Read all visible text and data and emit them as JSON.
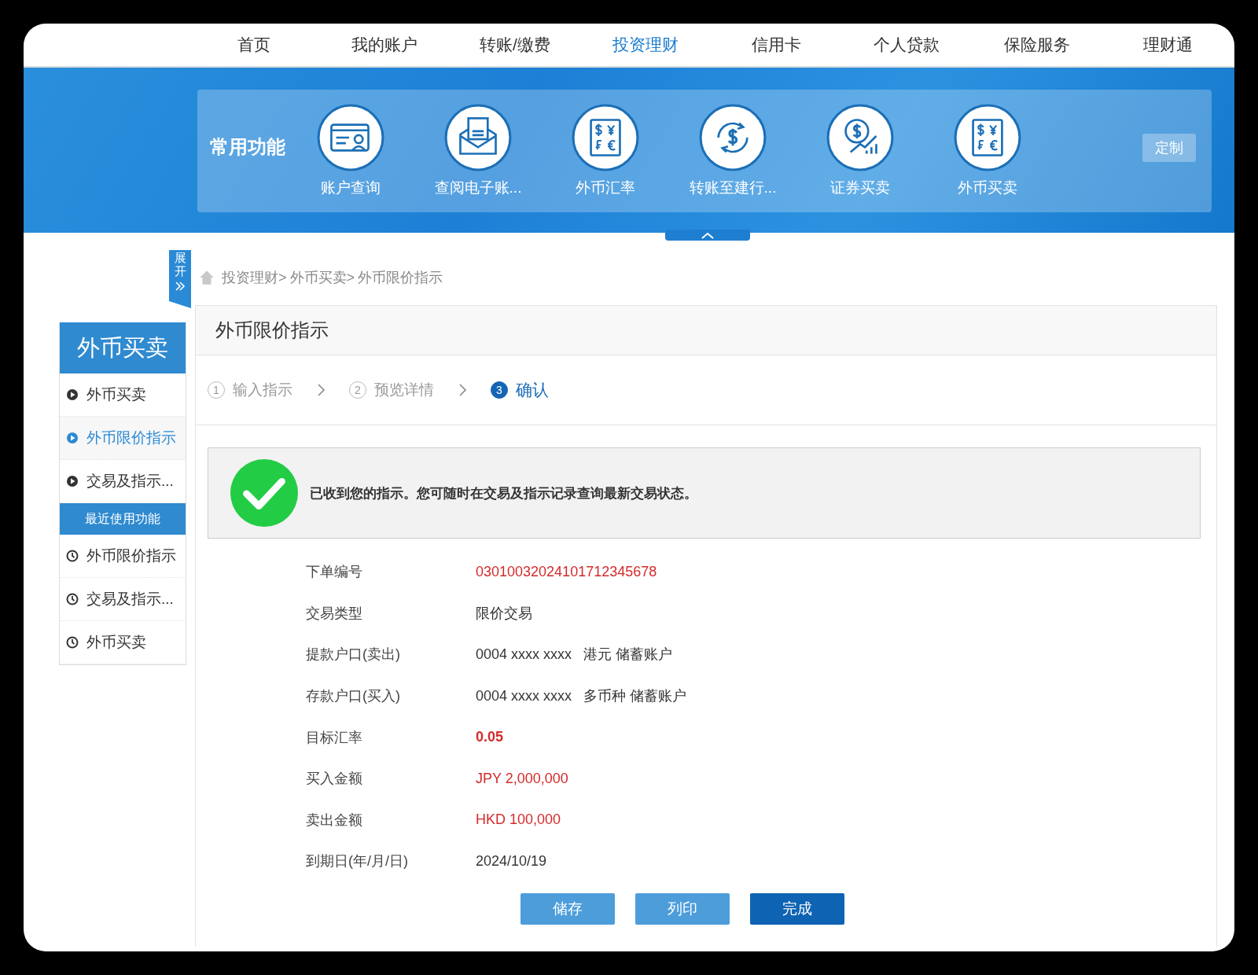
{
  "nav": [
    {
      "label": "首页",
      "selected": false
    },
    {
      "label": "我的账户",
      "selected": false
    },
    {
      "label": "转账/缴费",
      "selected": false
    },
    {
      "label": "投资理财",
      "selected": true
    },
    {
      "label": "信用卡",
      "selected": false
    },
    {
      "label": "个人贷款",
      "selected": false
    },
    {
      "label": "保险服务",
      "selected": false
    },
    {
      "label": "理财通",
      "selected": false
    }
  ],
  "quick": {
    "title": "常用功能",
    "customize": "定制",
    "items": [
      {
        "kind": "card",
        "label": "账户查询"
      },
      {
        "kind": "envelope",
        "label": "查阅电子账..."
      },
      {
        "kind": "currency",
        "label": "外币汇率"
      },
      {
        "kind": "transfer",
        "label": "转账至建行..."
      },
      {
        "kind": "chart",
        "label": "证券买卖"
      },
      {
        "kind": "currency",
        "label": "外币买卖"
      }
    ]
  },
  "expand_tab": "展开",
  "breadcrumb": [
    "投资理财>",
    "外币买卖>",
    "外币限价指示"
  ],
  "sidebar": {
    "title": "外币买卖",
    "items": [
      {
        "kind": "play",
        "label": "外币买卖",
        "selected": false
      },
      {
        "kind": "play",
        "label": "外币限价指示",
        "selected": true
      },
      {
        "kind": "play",
        "label": "交易及指示...",
        "selected": false
      }
    ],
    "recent_title": "最近使用功能",
    "recent": [
      {
        "kind": "clock",
        "label": "外币限价指示",
        "selected": false
      },
      {
        "kind": "clock",
        "label": "交易及指示...",
        "selected": false
      },
      {
        "kind": "clock",
        "label": "外币买卖",
        "selected": false
      }
    ]
  },
  "panel": {
    "title": "外币限价指示",
    "steps": [
      {
        "number": "1",
        "label": "输入指示",
        "selected": false
      },
      {
        "number": "2",
        "label": "预览详情",
        "selected": false
      },
      {
        "number": "3",
        "label": "确认",
        "selected": true
      }
    ],
    "message": "已收到您的指示。您可随时在交易及指示记录查询最新交易状态。",
    "details": [
      {
        "label": "下单编号",
        "value": "03010032024101712345678",
        "color": "#d42a2a",
        "bold": false
      },
      {
        "label": "交易类型",
        "value": "限价交易",
        "color": "#333333",
        "bold": false
      },
      {
        "label": "提款户口(卖出)",
        "value": "0004 xxxx xxxx   港元 储蓄账户",
        "color": "#333333",
        "bold": false
      },
      {
        "label": "存款户口(买入)",
        "value": "0004 xxxx xxxx   多币种 储蓄账户",
        "color": "#333333",
        "bold": false
      },
      {
        "label": "目标汇率",
        "value": "0.05",
        "color": "#d42a2a",
        "bold": true
      },
      {
        "label": "买入金额",
        "value": "JPY 2,000,000",
        "color": "#d42a2a",
        "bold": false
      },
      {
        "label": "卖出金额",
        "value": "HKD 100,000",
        "color": "#d42a2a",
        "bold": false
      },
      {
        "label": "到期日(年/月/日)",
        "value": "2024/10/19",
        "color": "#333333",
        "bold": false
      }
    ],
    "buttons": [
      {
        "label": "储存",
        "kind": "secondary"
      },
      {
        "label": "列印",
        "kind": "secondary"
      },
      {
        "label": "完成",
        "kind": "primary"
      }
    ]
  }
}
